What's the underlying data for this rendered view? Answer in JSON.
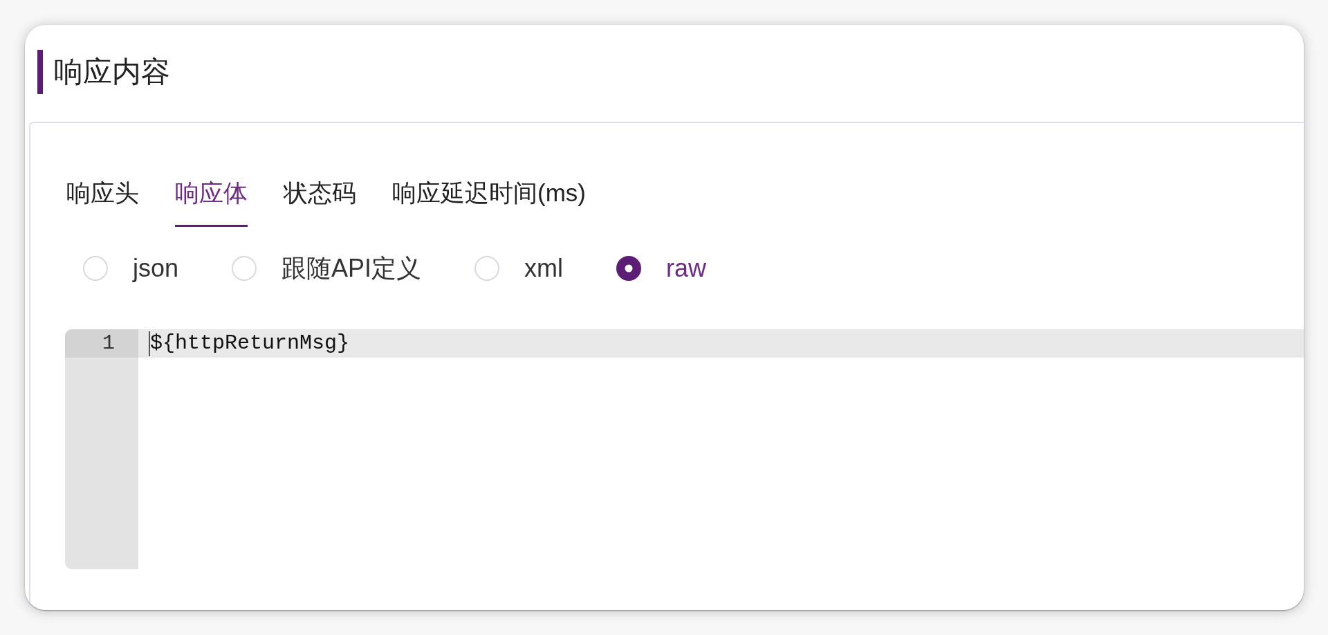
{
  "section": {
    "title": "响应内容"
  },
  "tabs": [
    {
      "label": "响应头",
      "selected": false
    },
    {
      "label": "响应体",
      "selected": true
    },
    {
      "label": "状态码",
      "selected": false
    },
    {
      "label": "响应延迟时间(ms)",
      "selected": false
    }
  ],
  "body_formats": [
    {
      "label": "json",
      "selected": false
    },
    {
      "label": "跟随API定义",
      "selected": false
    },
    {
      "label": "xml",
      "selected": false
    },
    {
      "label": "raw",
      "selected": true
    }
  ],
  "editor": {
    "lines": [
      {
        "number": "1",
        "text": "${httpReturnMsg}",
        "active": true
      }
    ]
  }
}
